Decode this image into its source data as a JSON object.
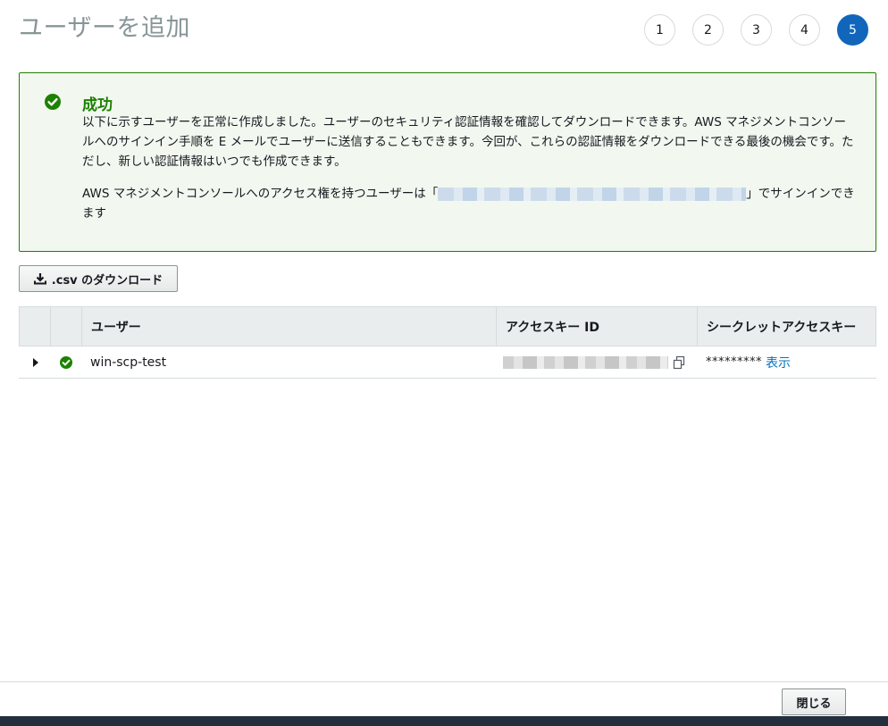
{
  "page": {
    "title": "ユーザーを追加"
  },
  "steps": [
    {
      "label": "1",
      "active": false
    },
    {
      "label": "2",
      "active": false
    },
    {
      "label": "3",
      "active": false
    },
    {
      "label": "4",
      "active": false
    },
    {
      "label": "5",
      "active": true
    }
  ],
  "alert": {
    "title": "成功",
    "message": "以下に示すユーザーを正常に作成しました。ユーザーのセキュリティ認証情報を確認してダウンロードできます。AWS マネジメントコンソールへのサインイン手順を E メールでユーザーに送信することもできます。今回が、これらの認証情報をダウンロードできる最後の機会です。ただし、新しい認証情報はいつでも作成できます。",
    "console_prefix": "AWS マネジメントコンソールへのアクセス権を持つユーザーは「",
    "console_suffix": "」でサインインできます"
  },
  "actions": {
    "download_csv": ".csv のダウンロード",
    "close": "閉じる"
  },
  "table": {
    "headers": {
      "user": "ユーザー",
      "access_key_id": "アクセスキー ID",
      "secret_access_key": "シークレットアクセスキー"
    },
    "rows": [
      {
        "user": "win-scp-test",
        "secret": "*********",
        "show": "表示"
      }
    ]
  },
  "colors": {
    "success": "#1d8102",
    "active_step": "#1166bb",
    "link": "#0073bb"
  }
}
